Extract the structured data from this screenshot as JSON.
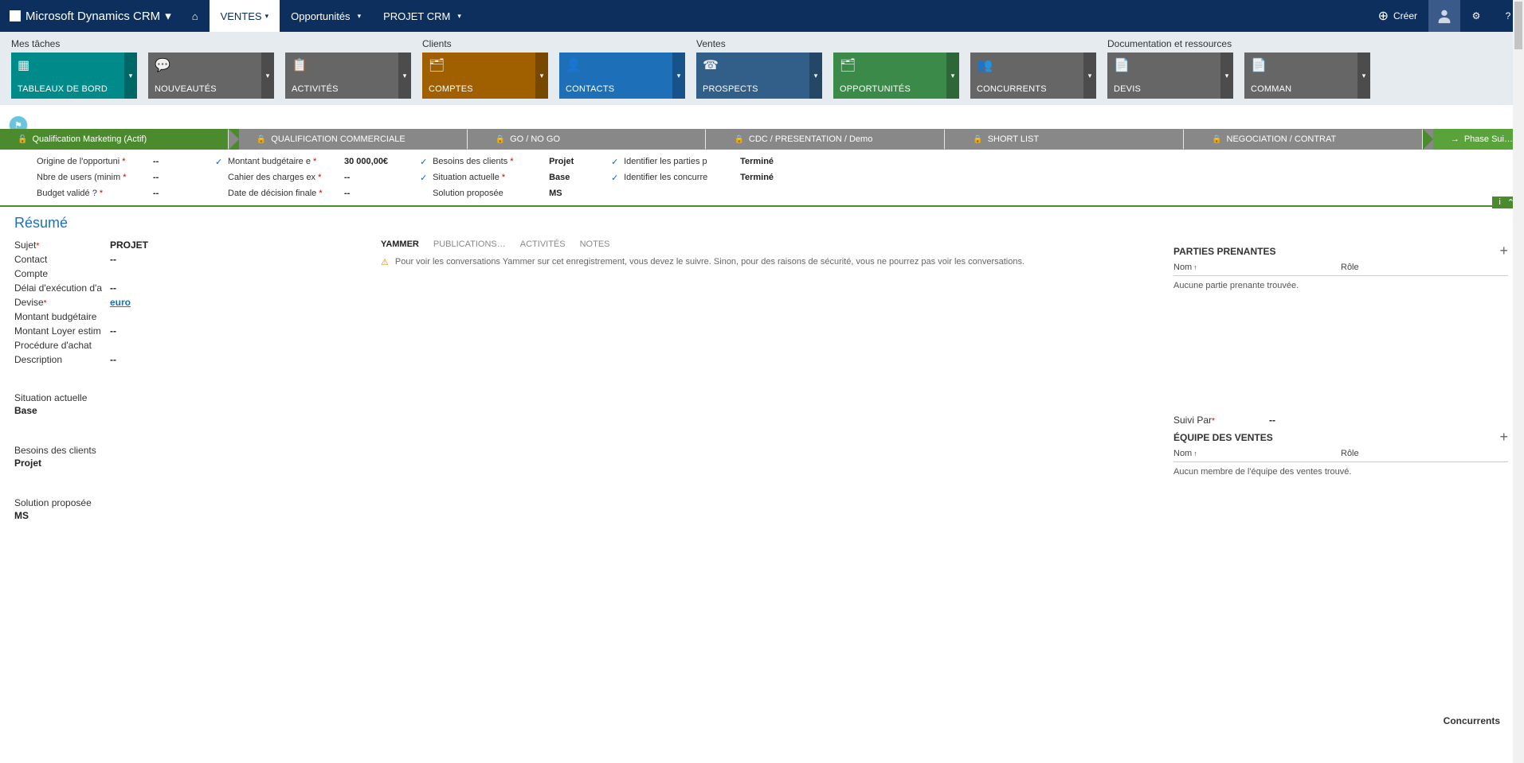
{
  "topbar": {
    "brand": "Microsoft Dynamics CRM",
    "nav": {
      "home": "⌂",
      "ventes": "VENTES",
      "opportunites": "Opportunités",
      "projet": "PROJET CRM"
    },
    "create": "Créer"
  },
  "tiles": {
    "groups": [
      {
        "label": "Mes tâches",
        "items": [
          {
            "label": "TABLEAUX DE BORD",
            "color": "tile-teal",
            "icon": "▦"
          },
          {
            "label": "NOUVEAUTÉS",
            "color": "tile-gray",
            "icon": "💬"
          },
          {
            "label": "ACTIVITÉS",
            "color": "tile-gray",
            "icon": "📋"
          }
        ]
      },
      {
        "label": "Clients",
        "items": [
          {
            "label": "COMPTES",
            "color": "tile-brown",
            "icon": "🗂"
          },
          {
            "label": "CONTACTS",
            "color": "tile-blue",
            "icon": "👤"
          }
        ]
      },
      {
        "label": "Ventes",
        "items": [
          {
            "label": "PROSPECTS",
            "color": "tile-dblue",
            "icon": "☎"
          },
          {
            "label": "OPPORTUNITÉS",
            "color": "tile-green",
            "icon": "🗂"
          },
          {
            "label": "CONCURRENTS",
            "color": "tile-gray",
            "icon": "👥"
          }
        ]
      },
      {
        "label": "Documentation et ressources",
        "items": [
          {
            "label": "DEVIS",
            "color": "tile-gray",
            "icon": "📄"
          },
          {
            "label": "COMMAN",
            "color": "tile-gray",
            "icon": "📄"
          }
        ]
      }
    ]
  },
  "process": {
    "stages": [
      {
        "label": "Qualification Marketing (Actif)",
        "active": true
      },
      {
        "label": "QUALIFICATION COMMERCIALE"
      },
      {
        "label": "GO / NO GO"
      },
      {
        "label": "CDC / PRESENTATION / Demo"
      },
      {
        "label": "SHORT LIST"
      },
      {
        "label": "NEGOCIATION / CONTRAT"
      }
    ],
    "next": "Phase Sui…",
    "fields": {
      "c1": [
        {
          "label": "Origine de l'opportuni",
          "req": true,
          "val": "--"
        },
        {
          "label": "Nbre de users (minim",
          "req": true,
          "val": "--"
        },
        {
          "label": "Budget validé ?",
          "req": true,
          "val": "--"
        }
      ],
      "c2": [
        {
          "chk": true,
          "label": "Montant budgétaire e",
          "req": true,
          "val": "30 000,00€"
        },
        {
          "label": "Cahier des charges ex",
          "req": true,
          "val": "--"
        },
        {
          "label": "Date de décision finale",
          "req": true,
          "val": "--"
        }
      ],
      "c3": [
        {
          "chk": true,
          "label": "Besoins des clients",
          "req": true,
          "val": "Projet"
        },
        {
          "chk": true,
          "label": "Situation actuelle",
          "req": true,
          "val": "Base"
        },
        {
          "label": "Solution proposée",
          "val": "MS"
        }
      ],
      "c4": [
        {
          "chk": true,
          "label": "Identifier les parties p",
          "val": "Terminé"
        },
        {
          "chk": true,
          "label": "Identifier les concurre",
          "val": "Terminé"
        }
      ]
    }
  },
  "form": {
    "section": "Résumé",
    "left": {
      "sujet": {
        "label": "Sujet",
        "val": "PROJET"
      },
      "contact": {
        "label": "Contact",
        "val": "--"
      },
      "compte": {
        "label": "Compte",
        "val": ""
      },
      "delai": {
        "label": "Délai d'exécution d'a",
        "val": "--"
      },
      "devise": {
        "label": "Devise",
        "val": "euro"
      },
      "montantb": {
        "label": "Montant budgétaire",
        "val": ""
      },
      "loyer": {
        "label": "Montant Loyer estim",
        "val": "--"
      },
      "proc": {
        "label": "Procédure d'achat",
        "val": ""
      },
      "desc": {
        "label": "Description",
        "val": "--"
      },
      "situation": {
        "label": "Situation actuelle",
        "val": "Base"
      },
      "besoins": {
        "label": "Besoins des clients",
        "val": "Projet"
      },
      "solution": {
        "label": "Solution proposée",
        "val": "MS"
      }
    },
    "mid": {
      "tabs": {
        "yammer": "YAMMER",
        "pub": "PUBLICATIONS…",
        "act": "ACTIVITÉS",
        "notes": "NOTES"
      },
      "yammer_msg": "Pour voir les conversations Yammer sur cet enregistrement, vous devez le suivre. Sinon, pour des raisons de sécurité, vous ne pourrez pas voir les conversations."
    },
    "right": {
      "parties": {
        "title": "PARTIES PRENANTES",
        "col_nom": "Nom",
        "col_role": "Rôle",
        "empty": "Aucune partie prenante trouvée."
      },
      "suivi": {
        "label": "Suivi Par",
        "val": "--"
      },
      "equipe": {
        "title": "ÉQUIPE DES VENTES",
        "col_nom": "Nom",
        "col_role": "Rôle",
        "empty": "Aucun membre de l'équipe des ventes trouvé."
      },
      "concurrents": "Concurrents"
    }
  }
}
